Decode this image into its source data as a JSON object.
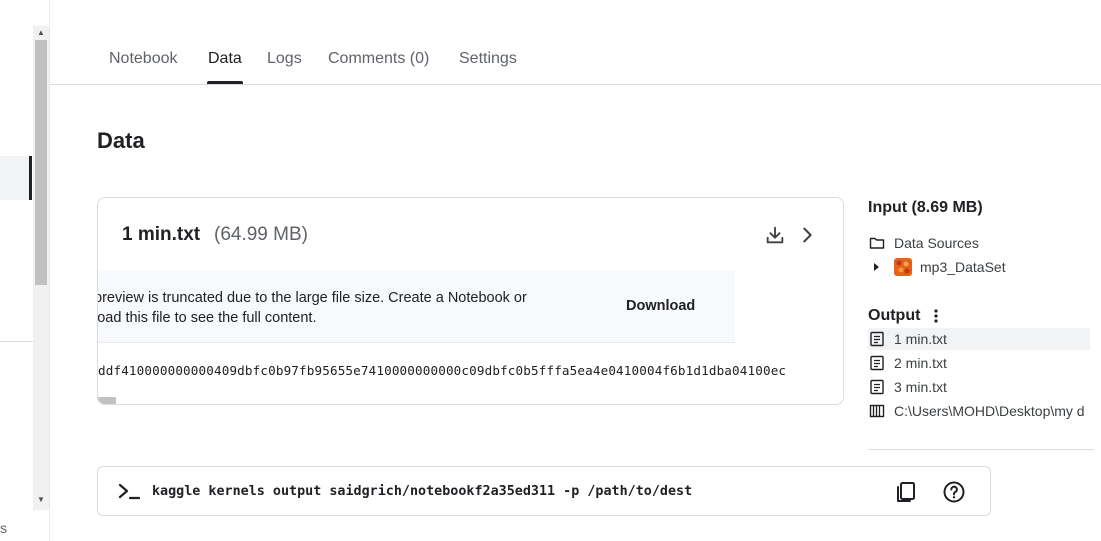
{
  "tabs": [
    {
      "label": "Notebook",
      "active": false
    },
    {
      "label": "Data",
      "active": true
    },
    {
      "label": "Logs",
      "active": false
    },
    {
      "label": "Comments (0)",
      "active": false
    },
    {
      "label": "Settings",
      "active": false
    }
  ],
  "sidebar": {
    "fragment": "s"
  },
  "page_title": "Data",
  "file_card": {
    "name": "1 min.txt",
    "size": "(64.99 MB)",
    "notice_line1": "preview is truncated due to the large file size. Create a Notebook or",
    "notice_line2": "load this file to see the full content.",
    "download_label": "Download",
    "preview_line": "ddf410000000000409dbfc0b97fb95655e7410000000000c09dbfc0b5fffa5ea4e0410004f6b1d1dba04100ec",
    "icons": [
      "download-icon",
      "chevron-right-icon"
    ]
  },
  "input": {
    "heading": "Input (8.69 MB)",
    "data_sources_label": "Data Sources",
    "dataset_label": "mp3_DataSet"
  },
  "output": {
    "heading": "Output",
    "files": [
      {
        "label": "1 min.txt",
        "selected": true,
        "icon": "file-text-icon"
      },
      {
        "label": "2 min.txt",
        "selected": false,
        "icon": "file-text-icon"
      },
      {
        "label": "3 min.txt",
        "selected": false,
        "icon": "file-text-icon"
      },
      {
        "label": "C:\\Users\\MOHD\\Desktop\\my d",
        "selected": false,
        "icon": "table-icon"
      }
    ]
  },
  "command": {
    "text": "kaggle kernels output saidgrich/notebookf2a35ed311 -p /path/to/dest",
    "icons": [
      "terminal-prompt-icon",
      "copy-icon",
      "help-icon"
    ]
  },
  "colors": {
    "text": "#202124",
    "muted": "#5f6368",
    "border": "#dadce0",
    "panel_bg": "#f8f9fa",
    "selected_bg": "#f1f3f4"
  }
}
